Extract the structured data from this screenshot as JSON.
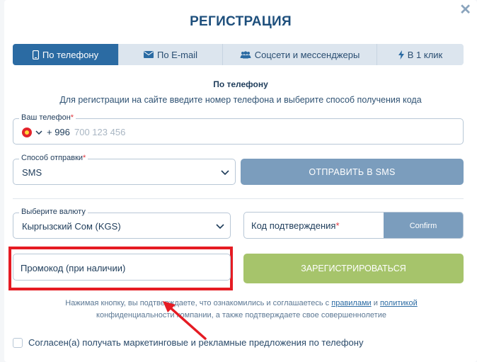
{
  "modal": {
    "title": "РЕГИСТРАЦИЯ",
    "close_glyph": "✕"
  },
  "tabs": [
    {
      "label": "По телефону",
      "icon": "phone-icon",
      "active": true
    },
    {
      "label": "По E-mail",
      "icon": "mail-icon",
      "active": false
    },
    {
      "label": "Соцсети и мессенджеры",
      "icon": "users-icon",
      "active": false
    },
    {
      "label": "В 1 клик",
      "icon": "lightning-icon",
      "active": false
    }
  ],
  "section": {
    "title": "По телефону",
    "description": "Для регистрации на сайте введите номер телефона и выберите способ получения кода"
  },
  "phone": {
    "label": "Ваш телефон",
    "required_mark": "*",
    "country_prefix": "+ 996",
    "placeholder": "700 123 456",
    "flag": "kyrgyzstan-flag"
  },
  "send_method": {
    "label": "Способ отправки",
    "required_mark": "*",
    "value": "SMS"
  },
  "send_sms_button": "ОТПРАВИТЬ В SMS",
  "currency": {
    "label": "Выберите валюту",
    "value": "Кыргызский Сом (KGS)"
  },
  "confirmation_code": {
    "label": "Код подтверждения",
    "required_mark": "*",
    "confirm_button": "Confirm"
  },
  "promo_code": {
    "label": "Промокод (при наличии)"
  },
  "register_button": "ЗАРЕГИСТРИРОВАТЬСЯ",
  "terms": {
    "part1": "Нажимая кнопку, вы подтверждаете, что ознакомились и соглашаетесь с ",
    "rules_link": "правилами",
    "and": " и ",
    "policy_link": "политикой",
    "part2": "конфиденциальности компании, а также подтверждаете свое совершеннолетие"
  },
  "marketing_consent": {
    "label": "Согласен(а) получать маркетинговые и рекламные предложения по телефону",
    "checked": false
  },
  "colors": {
    "primary": "#2b6ba3",
    "tab_bg": "#dce5ee",
    "disabled_button": "#7b9dbd",
    "register_button": "#a6c46b",
    "highlight": "#e51b23"
  }
}
